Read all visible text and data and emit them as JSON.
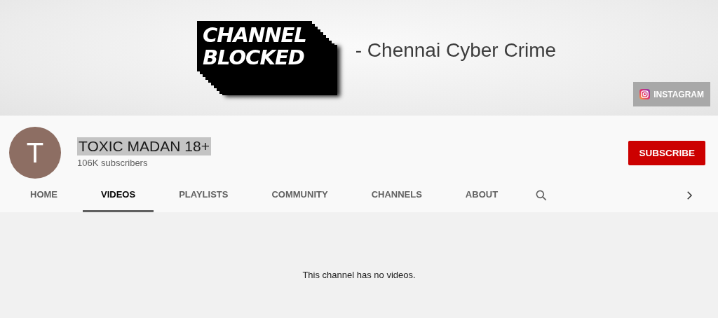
{
  "banner": {
    "logo_lines": [
      "CHANNEL",
      "BLOCKED"
    ],
    "tagline": "- Chennai Cyber Crime",
    "links": [
      {
        "label": "INSTAGRAM"
      }
    ]
  },
  "channel": {
    "avatar_letter": "T",
    "name": "TOXIC MADAN 18+",
    "name_highlighted": true,
    "subscribers": "106K subscribers",
    "subscribe_label": "SUBSCRIBE"
  },
  "tabs": [
    {
      "label": "HOME",
      "selected": false
    },
    {
      "label": "VIDEOS",
      "selected": true
    },
    {
      "label": "PLAYLISTS",
      "selected": false
    },
    {
      "label": "COMMUNITY",
      "selected": false
    },
    {
      "label": "CHANNELS",
      "selected": false
    },
    {
      "label": "ABOUT",
      "selected": false
    }
  ],
  "empty_message": "This channel has no videos."
}
